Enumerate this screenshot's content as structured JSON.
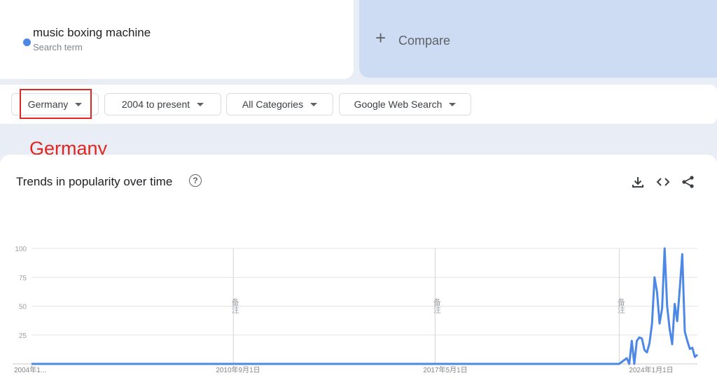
{
  "search": {
    "term": "music boxing machine",
    "term_sub": "Search term",
    "term_color": "#4d88e6",
    "compare_icon": "+",
    "compare_label": "Compare"
  },
  "filters": {
    "region": "Germany",
    "time": "2004 to present",
    "category": "All Categories",
    "property": "Google Web Search"
  },
  "annotation": {
    "label": "Germany",
    "color": "#e0261f"
  },
  "chart_section": {
    "title": "Trends in popularity over time",
    "help_icon": "?",
    "icons": [
      "download-icon",
      "embed-code-icon",
      "share-icon"
    ]
  },
  "chart_data": {
    "type": "line",
    "ylim": [
      0,
      100
    ],
    "y_ticks": [
      "100",
      "75",
      "50",
      "25"
    ],
    "x_tick_labels": [
      "2004年1...",
      "2010年9月1日",
      "2017年5月1日",
      "2024年1月1日"
    ],
    "note_label": "备注",
    "note_dates": [
      "2010-09",
      "2017-05",
      "2023-06"
    ],
    "series": [
      {
        "color": "#4d88e6",
        "x": [
          "2004-01",
          "2023-06",
          "2023-09",
          "2023-10",
          "2023-11",
          "2023-12",
          "2024-01",
          "2024-02",
          "2024-03",
          "2024-04",
          "2024-05",
          "2024-06",
          "2024-07",
          "2024-08",
          "2024-09",
          "2024-10",
          "2024-11",
          "2024-12",
          "2025-01",
          "2025-02",
          "2025-03",
          "2025-04",
          "2025-05",
          "2025-06",
          "2025-07",
          "2025-08",
          "2025-09",
          "2025-10",
          "2025-11",
          "2025-12",
          "2026-01"
        ],
        "y": [
          0,
          0,
          5,
          0,
          20,
          0,
          20,
          23,
          22,
          12,
          10,
          18,
          35,
          75,
          62,
          35,
          48,
          100,
          50,
          30,
          17,
          52,
          37,
          65,
          95,
          28,
          20,
          13,
          14,
          6,
          8
        ]
      }
    ]
  }
}
